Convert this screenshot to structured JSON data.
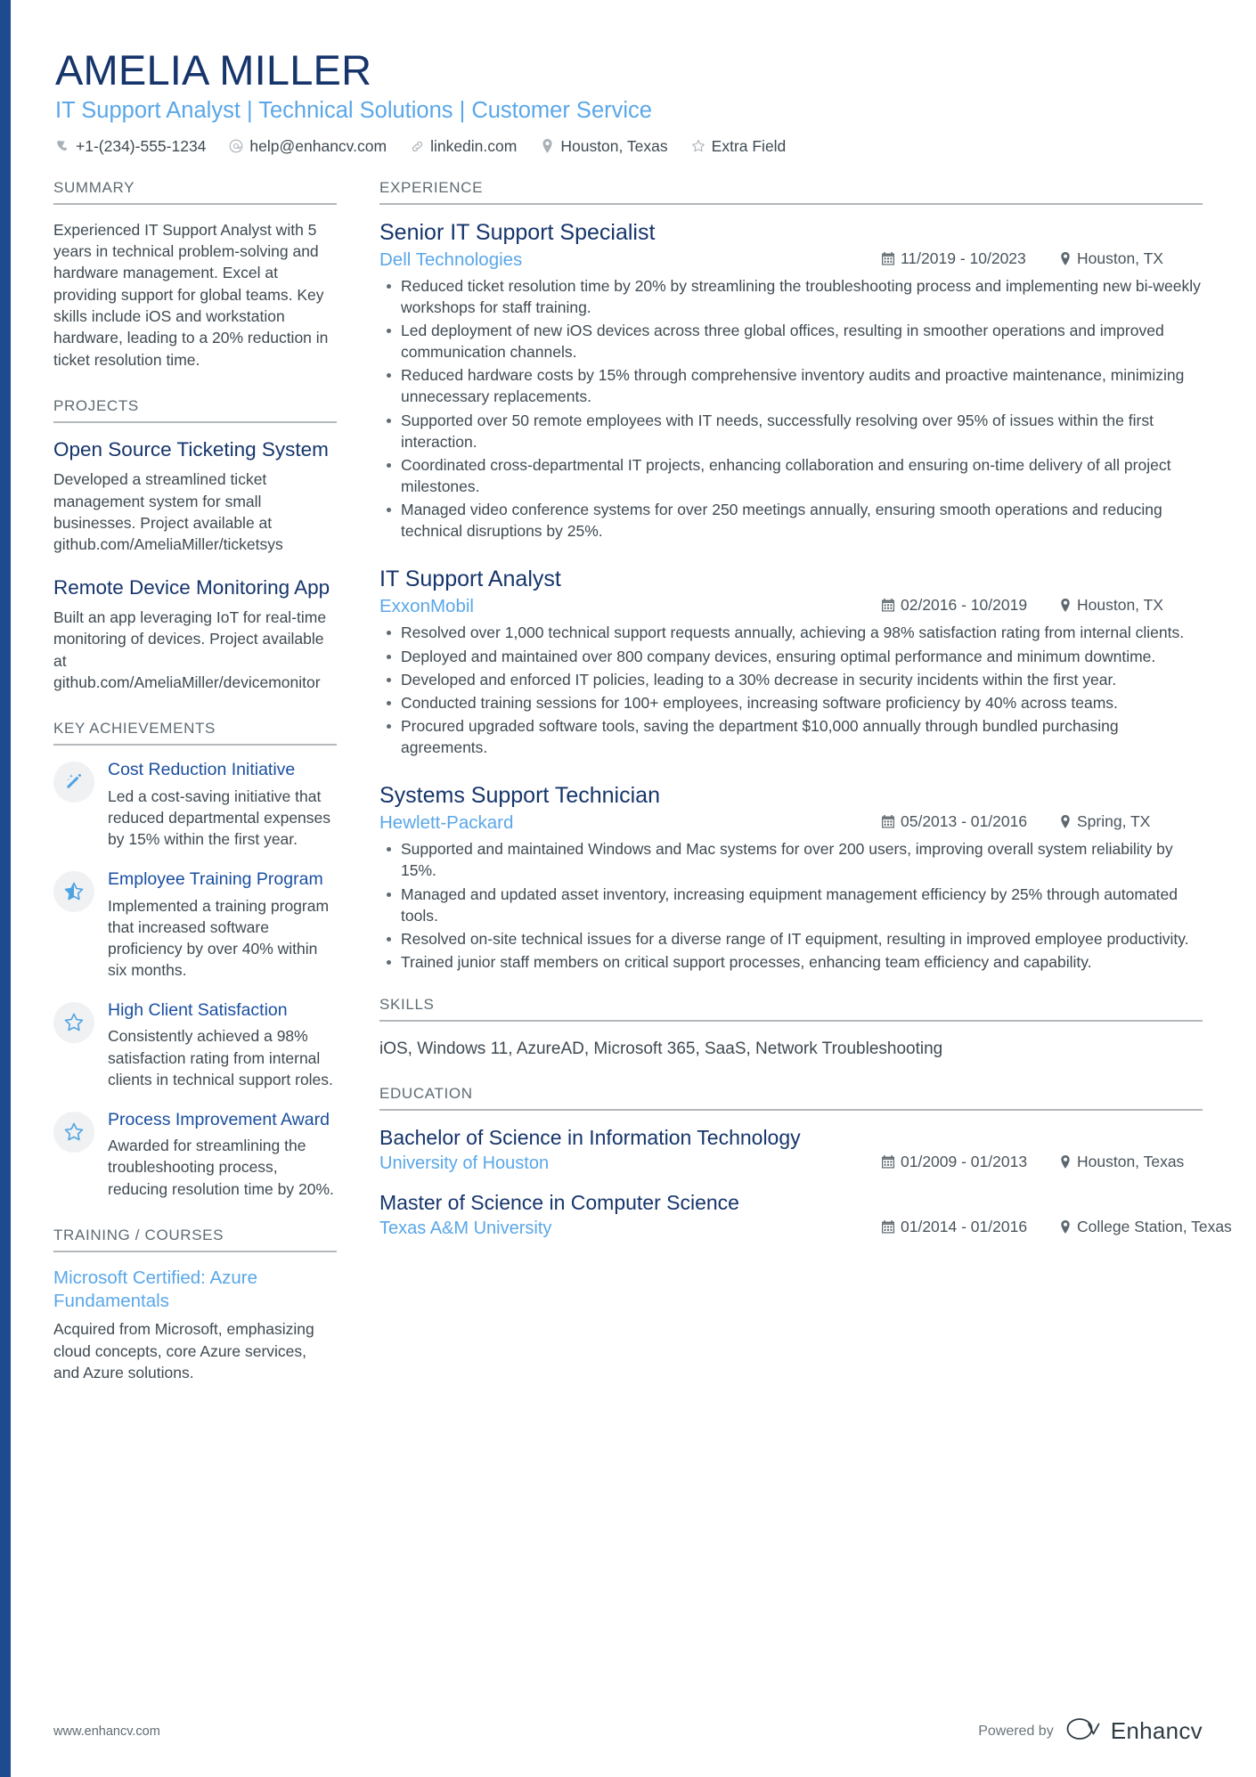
{
  "accent_color": "#1e4b8f",
  "header": {
    "name": "AMELIA MILLER",
    "headline": "IT Support Analyst | Technical Solutions | Customer Service",
    "contacts": [
      {
        "icon": "phone-icon",
        "text": "+1-(234)-555-1234"
      },
      {
        "icon": "email-icon",
        "text": "help@enhancv.com"
      },
      {
        "icon": "link-icon",
        "text": "linkedin.com"
      },
      {
        "icon": "location-icon",
        "text": "Houston, Texas"
      },
      {
        "icon": "star-icon",
        "text": "Extra Field"
      }
    ]
  },
  "sidebar": {
    "summary": {
      "heading": "SUMMARY",
      "text": "Experienced IT Support Analyst with 5 years in technical problem-solving and hardware management. Excel at providing support for global teams. Key skills include iOS and workstation hardware, leading to a 20% reduction in ticket resolution time."
    },
    "projects": {
      "heading": "PROJECTS",
      "items": [
        {
          "title": "Open Source Ticketing System",
          "description": "Developed a streamlined ticket management system for small businesses. Project available at github.com/AmeliaMiller/ticketsys"
        },
        {
          "title": "Remote Device Monitoring App",
          "description": "Built an app leveraging IoT for real-time monitoring of devices. Project available at github.com/AmeliaMiller/devicemonitor"
        }
      ]
    },
    "achievements": {
      "heading": "KEY ACHIEVEMENTS",
      "items": [
        {
          "icon": "magic-wand-icon",
          "title": "Cost Reduction Initiative",
          "description": "Led a cost-saving initiative that reduced departmental expenses by 15% within the first year."
        },
        {
          "icon": "star-half-icon",
          "title": "Employee Training Program",
          "description": "Implemented a training program that increased software proficiency by over 40% within six months."
        },
        {
          "icon": "star-outline-icon",
          "title": "High Client Satisfaction",
          "description": "Consistently achieved a 98% satisfaction rating from internal clients in technical support roles."
        },
        {
          "icon": "star-outline-icon",
          "title": "Process Improvement Award",
          "description": "Awarded for streamlining the troubleshooting process, reducing resolution time by 20%."
        }
      ]
    },
    "training": {
      "heading": "TRAINING / COURSES",
      "items": [
        {
          "title": "Microsoft Certified: Azure Fundamentals",
          "description": "Acquired from Microsoft, emphasizing cloud concepts, core Azure services, and Azure solutions."
        }
      ]
    }
  },
  "main": {
    "experience": {
      "heading": "EXPERIENCE",
      "jobs": [
        {
          "title": "Senior IT Support Specialist",
          "company": "Dell Technologies",
          "dates": "11/2019 - 10/2023",
          "location": "Houston, TX",
          "bullets": [
            "Reduced ticket resolution time by 20% by streamlining the troubleshooting process and implementing new bi-weekly workshops for staff training.",
            "Led deployment of new iOS devices across three global offices, resulting in smoother operations and improved communication channels.",
            "Reduced hardware costs by 15% through comprehensive inventory audits and proactive maintenance, minimizing unnecessary replacements.",
            "Supported over 50 remote employees with IT needs, successfully resolving over 95% of issues within the first interaction.",
            "Coordinated cross-departmental IT projects, enhancing collaboration and ensuring on-time delivery of all project milestones.",
            "Managed video conference systems for over 250 meetings annually, ensuring smooth operations and reducing technical disruptions by 25%."
          ]
        },
        {
          "title": "IT Support Analyst",
          "company": "ExxonMobil",
          "dates": "02/2016 - 10/2019",
          "location": "Houston, TX",
          "bullets": [
            "Resolved over 1,000 technical support requests annually, achieving a 98% satisfaction rating from internal clients.",
            "Deployed and maintained over 800 company devices, ensuring optimal performance and minimum downtime.",
            "Developed and enforced IT policies, leading to a 30% decrease in security incidents within the first year.",
            "Conducted training sessions for 100+ employees, increasing software proficiency by 40% across teams.",
            "Procured upgraded software tools, saving the department $10,000 annually through bundled purchasing agreements."
          ]
        },
        {
          "title": "Systems Support Technician",
          "company": "Hewlett-Packard",
          "dates": "05/2013 - 01/2016",
          "location": "Spring, TX",
          "bullets": [
            "Supported and maintained Windows and Mac systems for over 200 users, improving overall system reliability by 15%.",
            "Managed and updated asset inventory, increasing equipment management efficiency by 25% through automated tools.",
            "Resolved on-site technical issues for a diverse range of IT equipment, resulting in improved employee productivity.",
            "Trained junior staff members on critical support processes, enhancing team efficiency and capability."
          ]
        }
      ]
    },
    "skills": {
      "heading": "SKILLS",
      "text": "iOS, Windows 11, AzureAD, Microsoft 365, SaaS, Network Troubleshooting"
    },
    "education": {
      "heading": "EDUCATION",
      "items": [
        {
          "degree": "Bachelor of Science in Information Technology",
          "school": "University of Houston",
          "dates": "01/2009 - 01/2013",
          "location": "Houston, Texas"
        },
        {
          "degree": "Master of Science in Computer Science",
          "school": "Texas A&M University",
          "dates": "01/2014 - 01/2016",
          "location": "College Station, Texas"
        }
      ]
    }
  },
  "footer": {
    "url": "www.enhancv.com",
    "powered_by": "Powered by",
    "brand_name": "Enhancv"
  }
}
